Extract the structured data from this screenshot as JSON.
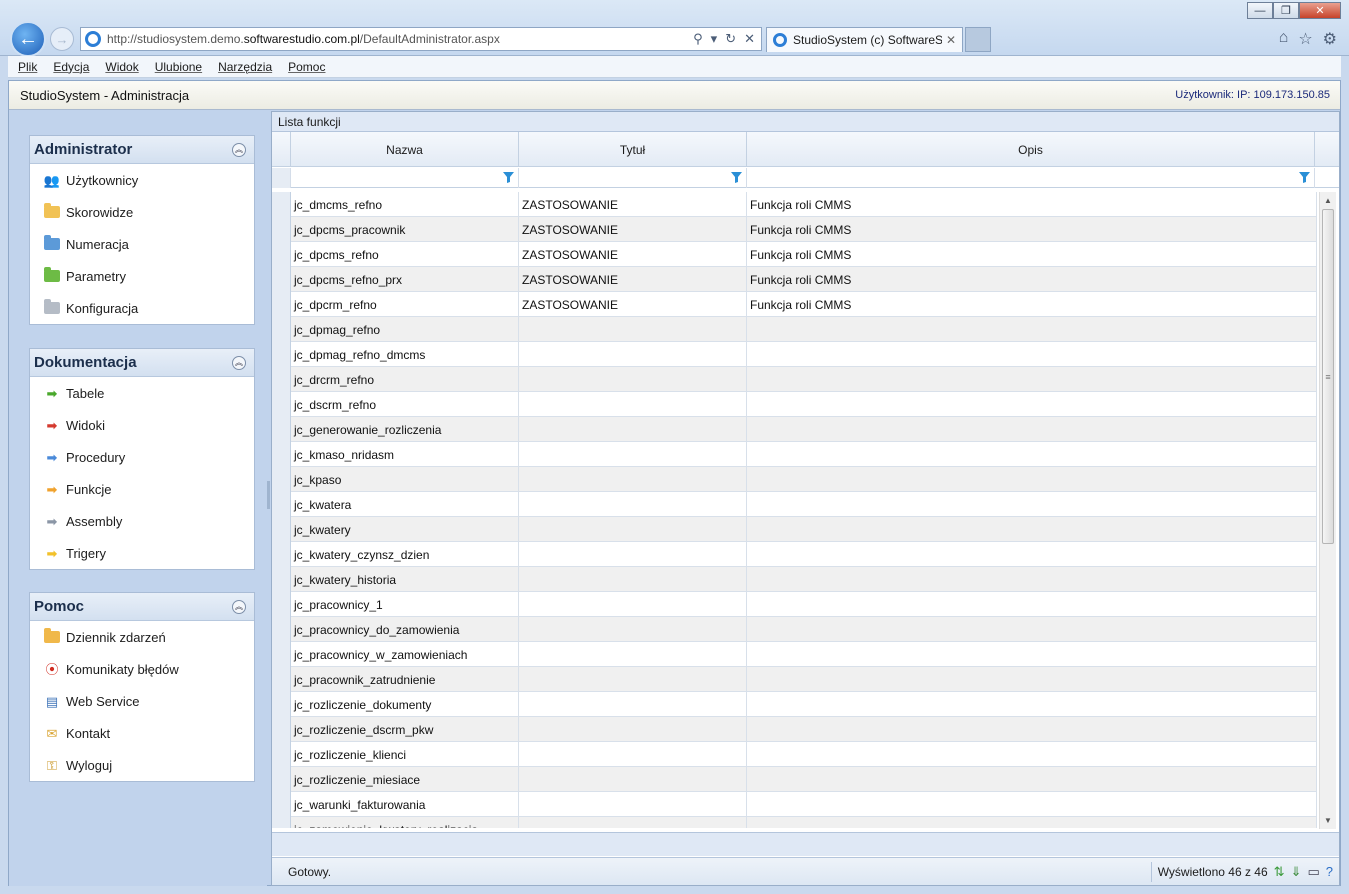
{
  "browser": {
    "url_prefix": "http://studiosystem.demo.",
    "url_domain": "softwarestudio.com.pl",
    "url_path": "/DefaultAdministrator.aspx",
    "tab_title": "StudioSystem (c) SoftwareS...",
    "tab_close": "✕",
    "menu": [
      "Plik",
      "Edycja",
      "Widok",
      "Ulubione",
      "Narzędzia",
      "Pomoc"
    ]
  },
  "app": {
    "title": "StudioSystem - Administracja",
    "user": "Użytkownik: IP: 109.173.150.85"
  },
  "sidebar": {
    "panels": [
      {
        "title": "Administrator",
        "items": [
          {
            "label": "Użytkownicy",
            "icon": "users-icon"
          },
          {
            "label": "Skorowidze",
            "icon": "folder-yellow-icon"
          },
          {
            "label": "Numeracja",
            "icon": "folder-blue-icon"
          },
          {
            "label": "Parametry",
            "icon": "folder-green-icon"
          },
          {
            "label": "Konfiguracja",
            "icon": "folder-gray-icon"
          }
        ]
      },
      {
        "title": "Dokumentacja",
        "items": [
          {
            "label": "Tabele",
            "icon": "arrow-green-icon"
          },
          {
            "label": "Widoki",
            "icon": "arrow-red-icon"
          },
          {
            "label": "Procedury",
            "icon": "arrow-blue-icon"
          },
          {
            "label": "Funkcje",
            "icon": "arrow-orange-icon"
          },
          {
            "label": "Assembly",
            "icon": "arrow-gray-icon"
          },
          {
            "label": "Trigery",
            "icon": "arrow-yellow-icon"
          }
        ]
      },
      {
        "title": "Pomoc",
        "items": [
          {
            "label": "Dziennik zdarzeń",
            "icon": "log-icon"
          },
          {
            "label": "Komunikaty błędów",
            "icon": "error-icon"
          },
          {
            "label": "Web Service",
            "icon": "web-service-icon"
          },
          {
            "label": "Kontakt",
            "icon": "mail-icon"
          },
          {
            "label": "Wyloguj",
            "icon": "key-icon"
          }
        ]
      }
    ]
  },
  "grid": {
    "caption": "Lista funkcji",
    "columns": [
      "Nazwa",
      "Tytuł",
      "Opis"
    ],
    "rows": [
      [
        "jc_dmcms_refno",
        "ZASTOSOWANIE",
        "Funkcja roli CMMS"
      ],
      [
        "jc_dpcms_pracownik",
        "ZASTOSOWANIE",
        "Funkcja roli CMMS"
      ],
      [
        "jc_dpcms_refno",
        "ZASTOSOWANIE",
        "Funkcja roli CMMS"
      ],
      [
        "jc_dpcms_refno_prx",
        "ZASTOSOWANIE",
        "Funkcja roli CMMS"
      ],
      [
        "jc_dpcrm_refno",
        "ZASTOSOWANIE",
        "Funkcja roli CMMS"
      ],
      [
        "jc_dpmag_refno",
        "",
        ""
      ],
      [
        "jc_dpmag_refno_dmcms",
        "",
        ""
      ],
      [
        "jc_drcrm_refno",
        "",
        ""
      ],
      [
        "jc_dscrm_refno",
        "",
        ""
      ],
      [
        "jc_generowanie_rozliczenia",
        "",
        ""
      ],
      [
        "jc_kmaso_nridasm",
        "",
        ""
      ],
      [
        "jc_kpaso",
        "",
        ""
      ],
      [
        "jc_kwatera",
        "",
        ""
      ],
      [
        "jc_kwatery",
        "",
        ""
      ],
      [
        "jc_kwatery_czynsz_dzien",
        "",
        ""
      ],
      [
        "jc_kwatery_historia",
        "",
        ""
      ],
      [
        "jc_pracownicy_1",
        "",
        ""
      ],
      [
        "jc_pracownicy_do_zamowienia",
        "",
        ""
      ],
      [
        "jc_pracownicy_w_zamowieniach",
        "",
        ""
      ],
      [
        "jc_pracownik_zatrudnienie",
        "",
        ""
      ],
      [
        "jc_rozliczenie_dokumenty",
        "",
        ""
      ],
      [
        "jc_rozliczenie_dscrm_pkw",
        "",
        ""
      ],
      [
        "jc_rozliczenie_klienci",
        "",
        ""
      ],
      [
        "jc_rozliczenie_miesiace",
        "",
        ""
      ],
      [
        "jc_warunki_fakturowania",
        "",
        ""
      ],
      [
        "jc_zamowienie_kwatery_realizacja",
        "",
        ""
      ]
    ],
    "status": "Gotowy.",
    "count": "Wyświetlono 46 z 46"
  }
}
